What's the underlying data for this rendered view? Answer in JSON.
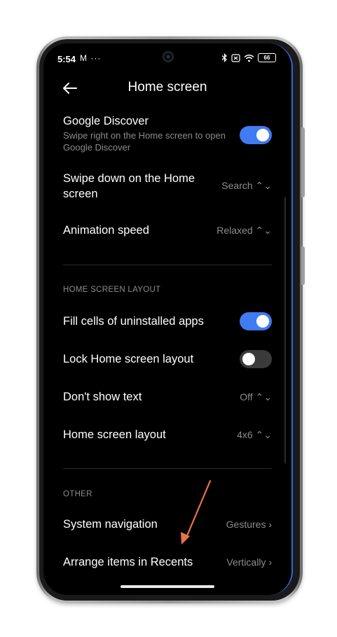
{
  "status_bar": {
    "time": "5:54",
    "left_icons": "M ···",
    "battery": "66"
  },
  "header": {
    "title": "Home screen"
  },
  "settings": {
    "google_discover": {
      "title": "Google Discover",
      "subtitle": "Swipe right on the Home screen to open Google Discover",
      "enabled": true
    },
    "swipe_down": {
      "title": "Swipe down on the Home screen",
      "value": "Search ⌃⌄"
    },
    "animation_speed": {
      "title": "Animation speed",
      "value": "Relaxed ⌃⌄"
    },
    "layout_section": "HOME SCREEN LAYOUT",
    "fill_cells": {
      "title": "Fill cells of uninstalled apps",
      "enabled": true
    },
    "lock_layout": {
      "title": "Lock Home screen layout",
      "enabled": false
    },
    "dont_show_text": {
      "title": "Don't show text",
      "value": "Off ⌃⌄"
    },
    "home_layout": {
      "title": "Home screen layout",
      "value": "4x6 ⌃⌄"
    },
    "other_section": "OTHER",
    "system_navigation": {
      "title": "System navigation",
      "value": "Gestures ›"
    },
    "arrange_recents": {
      "title": "Arrange items in Recents",
      "value": "Vertically ›"
    }
  },
  "colors": {
    "accent": "#3f7bf2",
    "annotation_arrow": "#e8734a",
    "background": "#000000",
    "secondary_text": "#8c8c8c"
  },
  "icons": {
    "back": "back-arrow-icon",
    "bluetooth": "bluetooth-icon",
    "wifi": "wifi-icon",
    "battery": "battery-icon"
  }
}
